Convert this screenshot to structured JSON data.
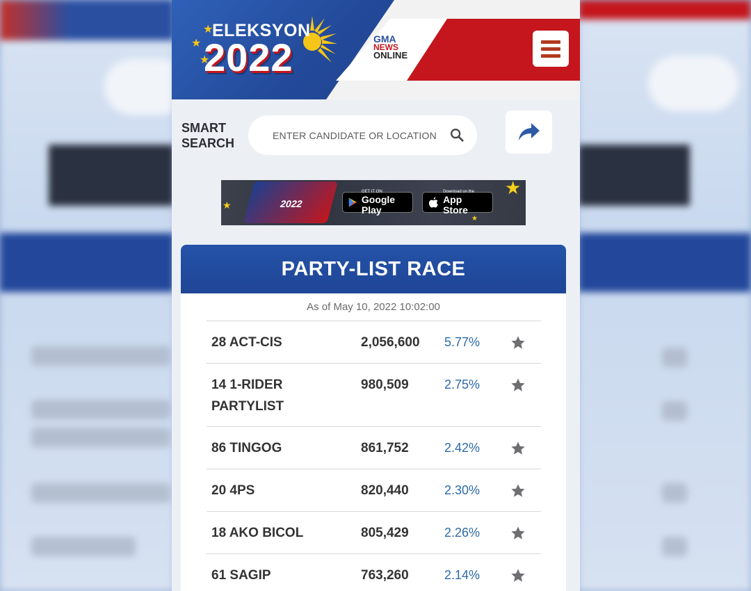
{
  "header": {
    "logo_title": "ELEKSYON",
    "logo_year": "2022",
    "brand_line1": "GMA",
    "brand_line2": "NEWS",
    "brand_line3": "ONLINE"
  },
  "search": {
    "label": "SMART SEARCH",
    "placeholder": "ENTER CANDIDATE OR LOCATION"
  },
  "app_banner": {
    "phone_text": "2022",
    "google_small": "GET IT ON",
    "google_big": "Google Play",
    "apple_small": "Download on the",
    "apple_big": "App Store"
  },
  "race": {
    "title": "PARTY-LIST RACE",
    "as_of": "As of May 10, 2022 10:02:00",
    "rows": [
      {
        "name": "28 ACT-CIS",
        "votes": "2,056,600",
        "pct": "5.77%"
      },
      {
        "name": "14 1-RIDER PARTYLIST",
        "votes": "980,509",
        "pct": "2.75%"
      },
      {
        "name": "86 TINGOG",
        "votes": "861,752",
        "pct": "2.42%"
      },
      {
        "name": "20 4PS",
        "votes": "820,440",
        "pct": "2.30%"
      },
      {
        "name": "18 AKO BICOL",
        "votes": "805,429",
        "pct": "2.26%"
      },
      {
        "name": "61 SAGIP",
        "votes": "763,260",
        "pct": "2.14%"
      }
    ]
  },
  "colors": {
    "brand_blue": "#234a9a",
    "brand_red": "#c4161c",
    "pct_blue": "#2c6ba8",
    "star_gray": "#6e6e72"
  },
  "icons": [
    "hamburger-menu-icon",
    "search-icon",
    "share-arrow-icon",
    "star-icon",
    "google-play-icon",
    "apple-icon"
  ]
}
